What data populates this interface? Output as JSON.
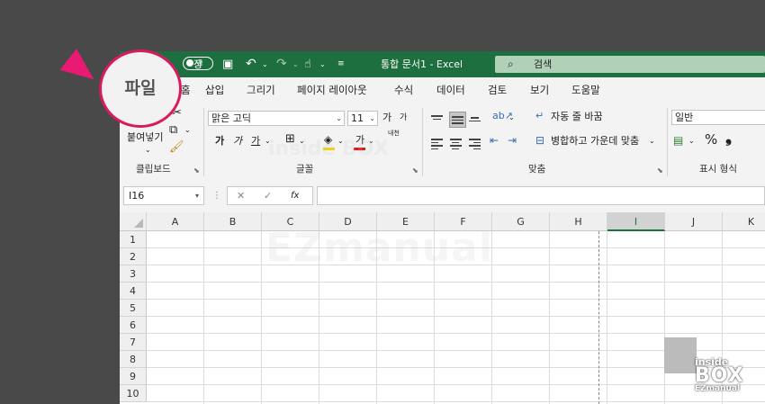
{
  "titlebar": {
    "autosave_label": "장",
    "toggle_label": "끔",
    "doc_title": "통합 문서1 - Excel",
    "search_placeholder": "검색"
  },
  "tabs": [
    "홈",
    "삽입",
    "그리기",
    "페이지 레이아웃",
    "수식",
    "데이터",
    "검토",
    "보기",
    "도움말"
  ],
  "callout": {
    "label": "파일",
    "color": "#d81b60",
    "arrow_color": "#e81a74"
  },
  "ribbon": {
    "clipboard": {
      "paste_label": "붙여넣기",
      "group_label": "클립보드"
    },
    "font": {
      "font_name": "맑은 고딕",
      "font_size": "11",
      "grow": "가",
      "shrink": "가",
      "bold": "가",
      "italic": "가",
      "underline": "가",
      "font_color_letter": "가",
      "phonetic": "내천",
      "group_label": "글꼴"
    },
    "alignment": {
      "wrap_text": "자동 줄 바꿈",
      "merge_center": "병합하고 가운데 맞춤",
      "group_label": "맞춤"
    },
    "number": {
      "format": "일반",
      "percent": "%",
      "comma": "❟",
      "group_label": "표시 형식"
    }
  },
  "formula_bar": {
    "name_box": "I16",
    "fx": "fx"
  },
  "columns": [
    "A",
    "B",
    "C",
    "D",
    "E",
    "F",
    "G",
    "H",
    "I",
    "J",
    "K"
  ],
  "selected_column": "I",
  "rows": [
    "1",
    "2",
    "3",
    "4",
    "5",
    "6",
    "7",
    "8",
    "9",
    "10"
  ],
  "watermark": {
    "top": "inside BOX",
    "main": "EZmanual"
  },
  "logo": {
    "line1": "inside",
    "line2": "BOX",
    "line3": "EZmanual"
  },
  "colors": {
    "excel_green": "#1e6f3f",
    "background": "#494949"
  }
}
